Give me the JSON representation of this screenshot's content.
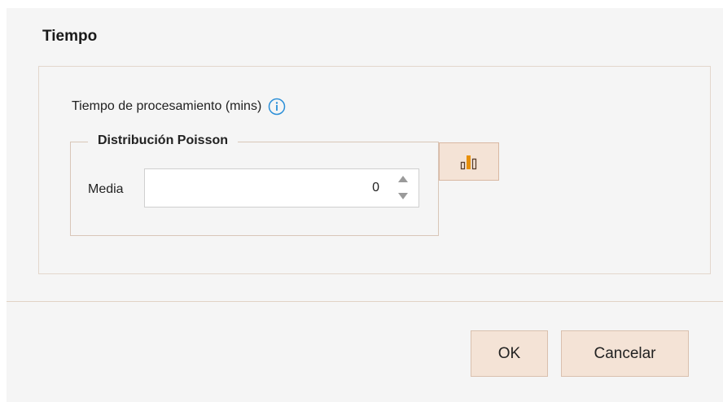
{
  "dialog": {
    "title": "Tiempo",
    "processing_label": "Tiempo de procesamiento (mins)",
    "distribution": {
      "legend": "Distribución Poisson",
      "media_label": "Media",
      "media_value": "0"
    },
    "buttons": {
      "ok": "OK",
      "cancel": "Cancelar"
    }
  },
  "icons": {
    "info": "info-icon",
    "chart": "bar-chart-icon",
    "spin_up": "chevron-up-icon",
    "spin_down": "chevron-down-icon"
  },
  "colors": {
    "accent_icon": "#e8900c",
    "info_blue": "#2b8fd8",
    "button_bg": "#f4e3d6",
    "panel_bg": "#f5f5f5"
  }
}
